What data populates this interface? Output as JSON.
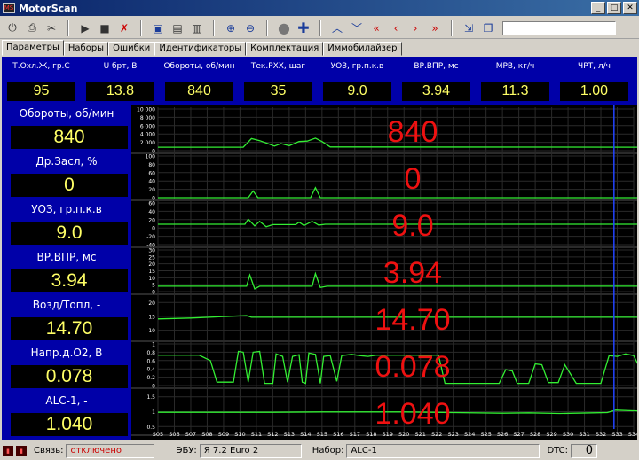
{
  "window": {
    "title": "MotorScan",
    "app_icon_text": "MS"
  },
  "toolbar_icons": [
    "power-icon",
    "print-icon",
    "tools-icon",
    "play-icon",
    "stop-icon",
    "delete-icon",
    "save-icon",
    "open-icon",
    "folder-icon",
    "zoom-in-icon",
    "zoom-out-icon",
    "record-icon",
    "add-icon",
    "up-icon",
    "down-icon",
    "first-icon",
    "prev-icon",
    "next-icon",
    "last-icon",
    "export-icon",
    "window-icon"
  ],
  "tabs": [
    "Параметры",
    "Наборы",
    "Ошибки",
    "Идентификаторы",
    "Комплектация",
    "Иммобилайзер"
  ],
  "top_params": [
    {
      "label": "Т.Охл.Ж, гр.С",
      "value": "95"
    },
    {
      "label": "U брт, В",
      "value": "13.8"
    },
    {
      "label": "Обороты, об/мин",
      "value": "840"
    },
    {
      "label": "Тек.РХХ, шаг",
      "value": "35"
    },
    {
      "label": "УОЗ, гр.п.к.в",
      "value": "9.0"
    },
    {
      "label": "ВР.ВПР, мс",
      "value": "3.94"
    },
    {
      "label": "МРВ, кг/ч",
      "value": "11.3"
    },
    {
      "label": "ЧРТ, л/ч",
      "value": "1.00"
    }
  ],
  "left_params": [
    {
      "label": "Обороты, об/мин",
      "value": "840"
    },
    {
      "label": "Др.Засл, %",
      "value": "0"
    },
    {
      "label": "УОЗ, гр.п.к.в",
      "value": "9.0"
    },
    {
      "label": "ВР.ВПР, мс",
      "value": "3.94"
    },
    {
      "label": "Возд/Топл, -",
      "value": "14.70"
    },
    {
      "label": "Напр.д.О2, В",
      "value": "0.078"
    },
    {
      "label": "ALC-1, -",
      "value": "1.040"
    }
  ],
  "status": {
    "link_label": "Связь:",
    "link_value": "отключено",
    "ecu_label": "ЭБУ:",
    "ecu_value": "Я 7.2 Euro 2",
    "set_label": "Набор:",
    "set_value": "ALC-1",
    "dtc_label": "DTC:",
    "dtc_value": "0"
  },
  "colors": {
    "panel_bg": "#0000a8",
    "value_text": "#ffff66",
    "trace": "#33ee33",
    "overlay": "#ee1111",
    "cursor": "#2244ff",
    "link_off": "#cc0000"
  },
  "chart_data": {
    "type": "line",
    "x_ticks": [
      "S05",
      "S06",
      "S07",
      "S08",
      "S09",
      "S10",
      "S11",
      "S12",
      "S13",
      "S14",
      "S15",
      "S16",
      "S17",
      "S18",
      "S19",
      "S20",
      "S21",
      "S22",
      "S23",
      "S24",
      "S25",
      "S26",
      "S27",
      "S28",
      "S29",
      "S30",
      "S31",
      "S32",
      "S33",
      "S34"
    ],
    "cursor_x": 27.8,
    "panels": [
      {
        "name": "Обороты, об/мин",
        "overlay": "840",
        "yticks": [
          "10 000",
          "8 000",
          "6 000",
          "4 000",
          "2 000",
          "0"
        ],
        "ylim": [
          0,
          10000
        ],
        "points": [
          [
            0,
            840
          ],
          [
            5.2,
            840
          ],
          [
            5.7,
            2900
          ],
          [
            6.2,
            2400
          ],
          [
            6.7,
            1700
          ],
          [
            7.1,
            1100
          ],
          [
            7.5,
            1700
          ],
          [
            8.0,
            1200
          ],
          [
            8.6,
            2200
          ],
          [
            9.1,
            2300
          ],
          [
            9.6,
            3000
          ],
          [
            10.0,
            2200
          ],
          [
            10.5,
            900
          ],
          [
            29.9,
            820
          ]
        ]
      },
      {
        "name": "Др.Засл, %",
        "overlay": "0",
        "yticks": [
          "100",
          "80",
          "60",
          "40",
          "20",
          "0"
        ],
        "ylim": [
          0,
          100
        ],
        "points": [
          [
            0,
            0
          ],
          [
            5.5,
            0
          ],
          [
            5.8,
            16
          ],
          [
            6.1,
            0
          ],
          [
            9.3,
            0
          ],
          [
            9.6,
            24
          ],
          [
            9.9,
            0
          ],
          [
            29.9,
            0
          ]
        ]
      },
      {
        "name": "УОЗ, гр.п.к.в",
        "overlay": "9.0",
        "yticks": [
          "60",
          "40",
          "20",
          "0",
          "-20",
          "-40"
        ],
        "ylim": [
          -40,
          60
        ],
        "points": [
          [
            0,
            9
          ],
          [
            5.3,
            9
          ],
          [
            5.5,
            21
          ],
          [
            5.9,
            5
          ],
          [
            6.2,
            16
          ],
          [
            6.6,
            3
          ],
          [
            7.0,
            8
          ],
          [
            8.4,
            8
          ],
          [
            8.6,
            14
          ],
          [
            8.9,
            6
          ],
          [
            9.4,
            16
          ],
          [
            9.8,
            7
          ],
          [
            10.2,
            9
          ],
          [
            29.9,
            9
          ]
        ]
      },
      {
        "name": "ВР.ВПР, мс",
        "overlay": "3.94",
        "yticks": [
          "30",
          "25",
          "20",
          "15",
          "10",
          "5",
          "0"
        ],
        "ylim": [
          0,
          30
        ],
        "points": [
          [
            0,
            3.9
          ],
          [
            5.4,
            3.9
          ],
          [
            5.6,
            12
          ],
          [
            5.9,
            2
          ],
          [
            6.2,
            3.9
          ],
          [
            9.4,
            3.9
          ],
          [
            9.6,
            13
          ],
          [
            9.9,
            3
          ],
          [
            10.3,
            3.9
          ],
          [
            29.9,
            3.9
          ]
        ]
      },
      {
        "name": "Возд/Топл, -",
        "overlay": "14.70",
        "yticks": [
          "20",
          "15",
          "10"
        ],
        "ylim": [
          7,
          22
        ],
        "points": [
          [
            0,
            14.1
          ],
          [
            2.0,
            14.4
          ],
          [
            5.4,
            15.3
          ],
          [
            5.7,
            14.7
          ],
          [
            29.9,
            14.7
          ]
        ]
      },
      {
        "name": "Напр.д.О2, В",
        "overlay": "0.078",
        "yticks": [
          "1",
          "0.8",
          "0.6",
          "0.4",
          "0.2",
          "0"
        ],
        "ylim": [
          0,
          1
        ],
        "points": [
          [
            0,
            0.73
          ],
          [
            1.5,
            0.73
          ],
          [
            2.5,
            0.73
          ],
          [
            3.2,
            0.6
          ],
          [
            3.6,
            0.08
          ],
          [
            4.6,
            0.08
          ],
          [
            4.9,
            0.82
          ],
          [
            5.2,
            0.8
          ],
          [
            5.5,
            0.08
          ],
          [
            5.8,
            0.8
          ],
          [
            6.2,
            0.82
          ],
          [
            6.5,
            0.05
          ],
          [
            7.0,
            0.05
          ],
          [
            7.2,
            0.76
          ],
          [
            7.6,
            0.7
          ],
          [
            7.9,
            0.08
          ],
          [
            8.2,
            0.7
          ],
          [
            8.6,
            0.74
          ],
          [
            8.8,
            0.08
          ],
          [
            9.0,
            0.05
          ],
          [
            9.2,
            0.78
          ],
          [
            9.6,
            0.75
          ],
          [
            9.9,
            0.05
          ],
          [
            10.1,
            0.7
          ],
          [
            10.5,
            0.72
          ],
          [
            10.9,
            0.1
          ],
          [
            11.2,
            0.72
          ],
          [
            11.8,
            0.75
          ],
          [
            12.3,
            0.72
          ],
          [
            12.8,
            0.7
          ],
          [
            13.3,
            0.73
          ],
          [
            17.1,
            0.73
          ],
          [
            17.5,
            0.05
          ],
          [
            20.8,
            0.05
          ],
          [
            21.2,
            0.38
          ],
          [
            21.6,
            0.35
          ],
          [
            21.9,
            0.05
          ],
          [
            22.6,
            0.05
          ],
          [
            23.0,
            0.52
          ],
          [
            23.4,
            0.5
          ],
          [
            23.8,
            0.07
          ],
          [
            24.4,
            0.07
          ],
          [
            24.8,
            0.5
          ],
          [
            25.5,
            0.05
          ],
          [
            27.0,
            0.05
          ],
          [
            27.5,
            0.72
          ],
          [
            28.0,
            0.7
          ],
          [
            28.5,
            0.76
          ],
          [
            29.0,
            0.72
          ],
          [
            29.4,
            0.4
          ],
          [
            29.9,
            0.1
          ]
        ]
      },
      {
        "name": "ALC-1, -",
        "overlay": "1.040",
        "yticks": [
          "1.5",
          "1",
          "0.5"
        ],
        "ylim": [
          0.3,
          1.7
        ],
        "points": [
          [
            0,
            0.98
          ],
          [
            7.0,
            0.98
          ],
          [
            10.0,
            0.99
          ],
          [
            15.0,
            0.99
          ],
          [
            18.0,
            0.97
          ],
          [
            21.0,
            0.95
          ],
          [
            22.6,
            0.96
          ],
          [
            24.5,
            0.94
          ],
          [
            26.5,
            0.96
          ],
          [
            27.4,
            0.97
          ],
          [
            27.9,
            1.05
          ],
          [
            29.0,
            1.03
          ],
          [
            29.9,
            1.01
          ]
        ]
      }
    ]
  }
}
